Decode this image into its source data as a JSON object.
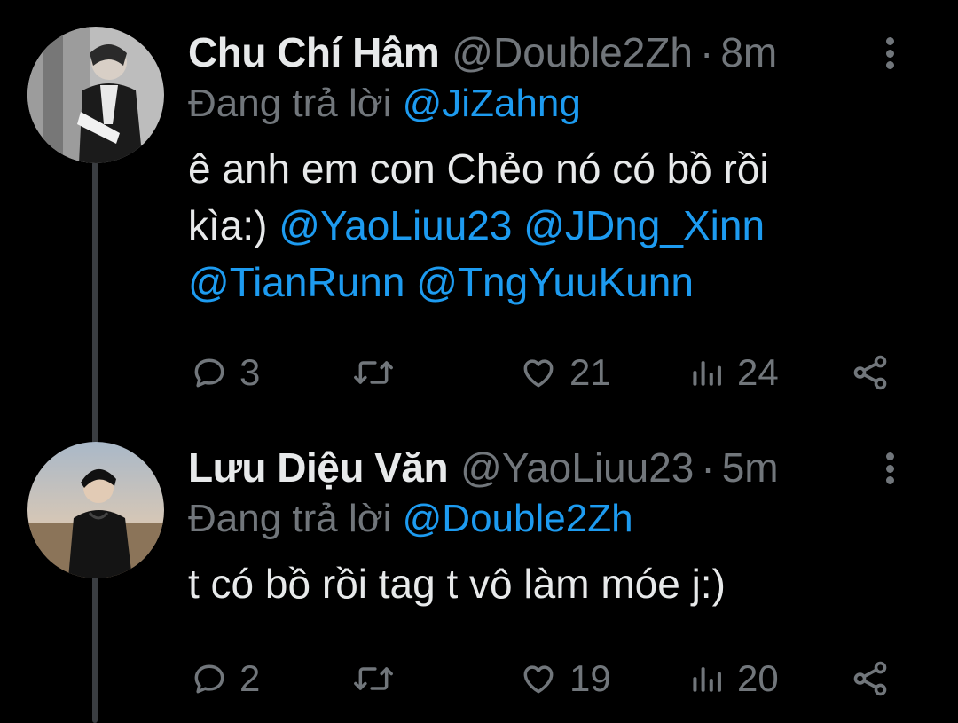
{
  "tweets": [
    {
      "name": "Chu Chí Hâm",
      "handle": "@Double2Zh",
      "separator": "·",
      "time": "8m",
      "reply_prefix": "Đang trả lời",
      "reply_to": "@JiZahng",
      "text_line1": "ê anh em con Chẻo nó có bồ rồi",
      "text_line2_prefix": "kìa:)",
      "mentions": [
        "@YaoLiuu23",
        "@JDng_Xinn",
        "@TianRunn",
        "@TngYuuKunn"
      ],
      "replies": "3",
      "likes": "21",
      "views": "24"
    },
    {
      "name": "Lưu Diệu Văn",
      "handle": "@YaoLiuu23",
      "separator": "·",
      "time": "5m",
      "reply_prefix": "Đang trả lời",
      "reply_to": "@Double2Zh",
      "text": "t có bồ rồi tag t vô làm móe j:)",
      "replies": "2",
      "likes": "19",
      "views": "20"
    }
  ],
  "icons": {
    "reply": "reply-bubble-icon",
    "retweet": "retweet-icon",
    "like": "heart-icon",
    "views": "analytics-bars-icon",
    "share": "share-icon",
    "more": "more-vertical-icon"
  },
  "colors": {
    "background": "#000000",
    "primary_text": "#e7e9ea",
    "secondary_text": "#71767b",
    "mention": "#1d9bf0",
    "thread_line": "#3a3d41"
  }
}
